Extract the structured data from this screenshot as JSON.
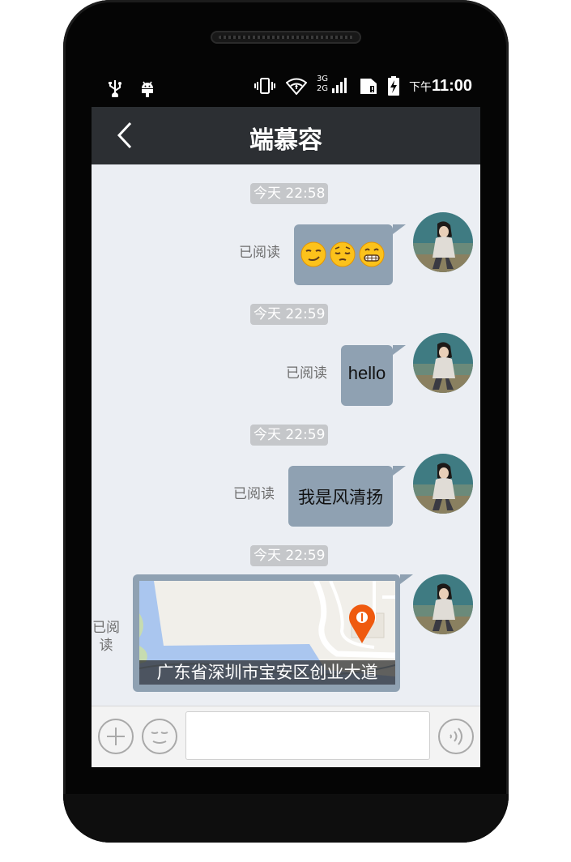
{
  "status_bar": {
    "icons_left": [
      "usb-icon",
      "android-debug-icon"
    ],
    "icons_right": [
      "vibrate-icon",
      "wifi-icon",
      "network-3g-2g-icon",
      "sim-icon",
      "battery-charging-icon"
    ],
    "network_label_top": "3G",
    "network_label_bottom": "2G",
    "time_prefix": "下午",
    "time": "11:00"
  },
  "header": {
    "title": "端慕容",
    "back_icon": "chevron-left-icon"
  },
  "messages": [
    {
      "timestamp": "今天 22:58",
      "type": "emoji",
      "emojis": [
        "smirk-emoji",
        "pensive-emoji",
        "grimace-emoji"
      ],
      "read_status": "已阅读"
    },
    {
      "timestamp": "今天 22:59",
      "type": "text",
      "text": "hello",
      "read_status": "已阅读"
    },
    {
      "timestamp": "今天 22:59",
      "type": "text",
      "text": "我是风清扬",
      "read_status": "已阅读"
    },
    {
      "timestamp": "今天 22:59",
      "type": "location",
      "address": "广东省深圳市宝安区创业大道",
      "read_status_line1": "已阅",
      "read_status_line2": "读"
    }
  ],
  "input_bar": {
    "plus_icon": "plus-icon",
    "emoji_icon": "emoji-face-icon",
    "voice_icon": "voice-icon",
    "input_value": ""
  },
  "colors": {
    "title_bar": "#2c2f33",
    "chat_bg": "#ebeef3",
    "bubble": "#8fa1b2",
    "timestamp_pill": "#c5c7ca",
    "map_pin": "#ef5a0f"
  }
}
